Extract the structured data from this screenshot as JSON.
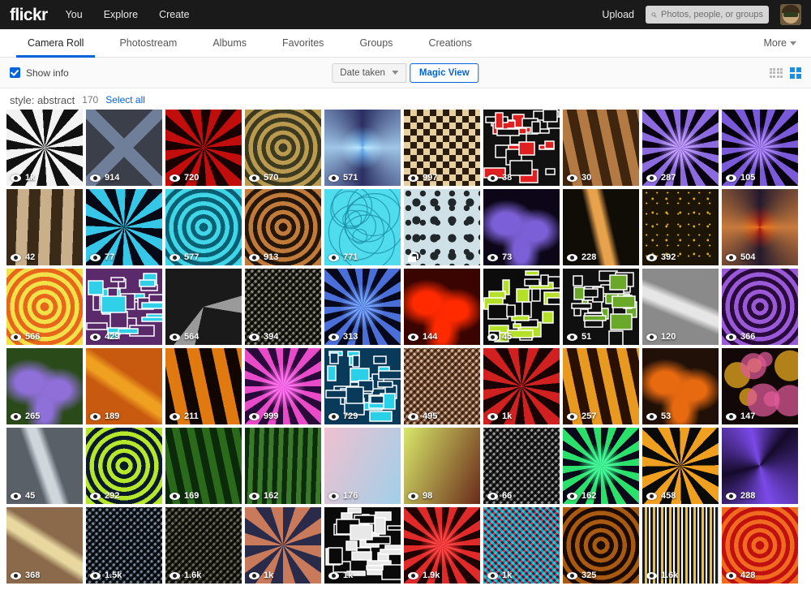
{
  "topbar": {
    "logo": "flickr",
    "nav": [
      {
        "label": "You"
      },
      {
        "label": "Explore"
      },
      {
        "label": "Create"
      }
    ],
    "upload_label": "Upload",
    "search_placeholder": "Photos, people, or groups",
    "search_value": "",
    "search_icon": "search-icon",
    "avatar_icon": "user-avatar"
  },
  "tabs": [
    {
      "label": "Camera Roll",
      "active": true
    },
    {
      "label": "Photostream",
      "active": false
    },
    {
      "label": "Albums",
      "active": false
    },
    {
      "label": "Favorites",
      "active": false
    },
    {
      "label": "Groups",
      "active": false
    },
    {
      "label": "Creations",
      "active": false
    }
  ],
  "more_label": "More",
  "toolbar": {
    "show_info_label": "Show info",
    "show_info_checked": true,
    "sort_label": "Date taken",
    "magic_view_label": "Magic View",
    "view_small_icon": "grid-small-icon",
    "view_large_icon": "grid-large-icon",
    "active_view": "large"
  },
  "meta": {
    "style_label": "style: abstract",
    "count": "170",
    "select_all_label": "Select all"
  },
  "colors": {
    "accent": "#0063dc",
    "topbar_bg": "#1a1a1a",
    "toolbar_bg": "#fafafa"
  },
  "photos": [
    {
      "views": "1k",
      "private": false,
      "a": "#f2f2f2",
      "b": "#111111",
      "art": "rays"
    },
    {
      "views": "914",
      "private": false,
      "a": "#6f7f9a",
      "b": "#3a3f4a",
      "art": "cross"
    },
    {
      "views": "720",
      "private": false,
      "a": "#c20d0d",
      "b": "#1a0000",
      "art": "rays"
    },
    {
      "views": "570",
      "private": false,
      "a": "#b99a4e",
      "b": "#3c3a20",
      "art": "rings"
    },
    {
      "views": "571",
      "private": false,
      "a": "#9fc6e8",
      "b": "#2b2f63",
      "art": "spiral"
    },
    {
      "views": "997",
      "private": false,
      "a": "#e8cfa0",
      "b": "#2a1c0c",
      "art": "checker"
    },
    {
      "views": "38",
      "private": false,
      "a": "#e02020",
      "b": "#111111",
      "art": "blocks"
    },
    {
      "views": "30",
      "private": false,
      "a": "#b37a44",
      "b": "#40250f",
      "art": "stripes"
    },
    {
      "views": "287",
      "private": false,
      "a": "#8b6bdd",
      "b": "#0a0012",
      "art": "burst"
    },
    {
      "views": "105",
      "private": false,
      "a": "#7a5ad8",
      "b": "#08000f",
      "art": "burst"
    },
    {
      "views": "42",
      "private": false,
      "a": "#c9b08a",
      "b": "#3a2a18",
      "art": "stripes"
    },
    {
      "views": "77",
      "private": false,
      "a": "#36c6e8",
      "b": "#060a16",
      "art": "rays"
    },
    {
      "views": "577",
      "private": false,
      "a": "#3fd6e8",
      "b": "#0b5f72",
      "art": "rings"
    },
    {
      "views": "913",
      "private": false,
      "a": "#c07a3a",
      "b": "#24170a",
      "art": "rings"
    },
    {
      "views": "771",
      "private": false,
      "a": "#4fdcec",
      "b": "#1c8fa6",
      "art": "circles"
    },
    {
      "views": "",
      "private": true,
      "a": "#cfe0e6",
      "b": "#20282c",
      "art": "dots"
    },
    {
      "views": "73",
      "private": false,
      "a": "#7b5fd6",
      "b": "#0c0618",
      "art": "blobs"
    },
    {
      "views": "228",
      "private": false,
      "a": "#e8a24c",
      "b": "#100c06",
      "art": "streak"
    },
    {
      "views": "392",
      "private": false,
      "a": "#e0a81c",
      "b": "#1c1405",
      "art": "leaf"
    },
    {
      "views": "504",
      "private": false,
      "a": "#c87a3c",
      "b": "#241a2c",
      "art": "spiral"
    },
    {
      "views": "566",
      "private": false,
      "a": "#f2e24a",
      "b": "#e8651c",
      "art": "rings"
    },
    {
      "views": "429",
      "private": false,
      "a": "#2fd0e8",
      "b": "#5a2a6a",
      "art": "blocks"
    },
    {
      "views": "564",
      "private": false,
      "a": "#9a9a9a",
      "b": "#1a1a1a",
      "art": "poly"
    },
    {
      "views": "394",
      "private": false,
      "a": "#8a8a7a",
      "b": "#2a2a22",
      "art": "mesh"
    },
    {
      "views": "313",
      "private": false,
      "a": "#4a6fd8",
      "b": "#06081c",
      "art": "burst"
    },
    {
      "views": "144",
      "private": false,
      "a": "#ff2a00",
      "b": "#3a0400",
      "art": "blobs"
    },
    {
      "views": "45",
      "private": false,
      "a": "#b5e02a",
      "b": "#0c0c0c",
      "art": "blocks"
    },
    {
      "views": "51",
      "private": false,
      "a": "#6aa82a",
      "b": "#101010",
      "art": "blocks"
    },
    {
      "views": "120",
      "private": false,
      "a": "#e6e6e6",
      "b": "#8a8a8a",
      "art": "streak"
    },
    {
      "views": "366",
      "private": false,
      "a": "#9a5ad8",
      "b": "#2a0a3a",
      "art": "rings"
    },
    {
      "views": "265",
      "private": false,
      "a": "#8f6fd8",
      "b": "#2a4a1a",
      "art": "blobs"
    },
    {
      "views": "189",
      "private": false,
      "a": "#f0a020",
      "b": "#c85a10",
      "art": "streak"
    },
    {
      "views": "211",
      "private": false,
      "a": "#e07a10",
      "b": "#120600",
      "art": "stripes"
    },
    {
      "views": "999",
      "private": false,
      "a": "#e84ac8",
      "b": "#2a0a3a",
      "art": "burst"
    },
    {
      "views": "729",
      "private": false,
      "a": "#2ad0e8",
      "b": "#0a3a5a",
      "art": "blocks"
    },
    {
      "views": "495",
      "private": false,
      "a": "#d8b49a",
      "b": "#7a5a42",
      "art": "mesh"
    },
    {
      "views": "1k",
      "private": false,
      "a": "#d02020",
      "b": "#1a0202",
      "art": "rays"
    },
    {
      "views": "257",
      "private": false,
      "a": "#e89a20",
      "b": "#2a1000",
      "art": "stripes"
    },
    {
      "views": "53",
      "private": false,
      "a": "#e86a10",
      "b": "#201008",
      "art": "blobs"
    },
    {
      "views": "147",
      "private": false,
      "a": "#f0b020",
      "b": "#e05a9a",
      "art": "bokeh"
    },
    {
      "views": "45",
      "private": false,
      "a": "#cfd6dc",
      "b": "#5a6068",
      "art": "streak"
    },
    {
      "views": "292",
      "private": false,
      "a": "#b5e82a",
      "b": "#0a1a2a",
      "art": "rings"
    },
    {
      "views": "169",
      "private": false,
      "a": "#2a6a1a",
      "b": "#0a2a0a",
      "art": "stripes"
    },
    {
      "views": "162",
      "private": false,
      "a": "#3a7a2a",
      "b": "#0c2c0c",
      "art": "stripes"
    },
    {
      "views": "176",
      "private": false,
      "a": "#f0c0d0",
      "b": "#a0d0e8",
      "art": "soft"
    },
    {
      "views": "98",
      "private": false,
      "a": "#d8e86a",
      "b": "#6a2a1a",
      "art": "soft"
    },
    {
      "views": "66",
      "private": false,
      "a": "#9a9a9a",
      "b": "#2a2a2a",
      "art": "mesh"
    },
    {
      "views": "162",
      "private": false,
      "a": "#2ae06a",
      "b": "#0a0a1a",
      "art": "burst"
    },
    {
      "views": "458",
      "private": false,
      "a": "#f0a020",
      "b": "#0a0a0a",
      "art": "rays"
    },
    {
      "views": "288",
      "private": false,
      "a": "#7a4ae8",
      "b": "#150a2a",
      "art": "swirl"
    },
    {
      "views": "368",
      "private": false,
      "a": "#e8d8a0",
      "b": "#8a6a4a",
      "art": "streak"
    },
    {
      "views": "1.5k",
      "private": false,
      "a": "#7a8a9a",
      "b": "#1a2028",
      "art": "mesh"
    },
    {
      "views": "1.6k",
      "private": false,
      "a": "#6a6a5a",
      "b": "#2a2a20",
      "art": "mesh"
    },
    {
      "views": "1k",
      "private": false,
      "a": "#c87a5a",
      "b": "#2a2a4a",
      "art": "petals"
    },
    {
      "views": "1k",
      "private": false,
      "a": "#e8e8e8",
      "b": "#0a0a0a",
      "art": "blocks"
    },
    {
      "views": "1.9k",
      "private": false,
      "a": "#e02a2a",
      "b": "#200000",
      "art": "burst"
    },
    {
      "views": "1k",
      "private": false,
      "a": "#e82a4a",
      "b": "#2accd8",
      "art": "mesh"
    },
    {
      "views": "325",
      "private": false,
      "a": "#a85a10",
      "b": "#1a0a00",
      "art": "rings"
    },
    {
      "views": "1.6k",
      "private": false,
      "a": "#f0c040",
      "b": "#1a1a1a",
      "art": "bars"
    },
    {
      "views": "428",
      "private": false,
      "a": "#f06a20",
      "b": "#c01010",
      "art": "rings"
    }
  ]
}
